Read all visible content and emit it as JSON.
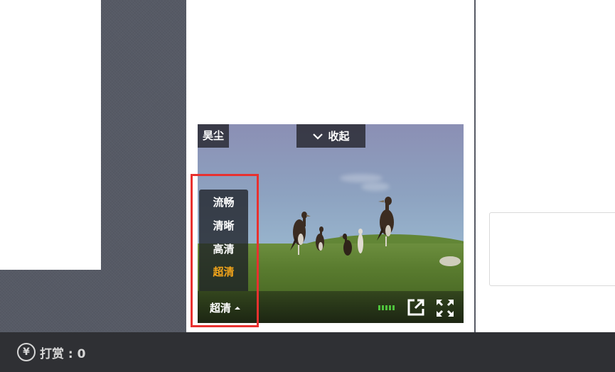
{
  "video": {
    "author_tag": "昊尘",
    "collapse_label": "收起",
    "quality": {
      "options": [
        "流畅",
        "清晰",
        "高清",
        "超清"
      ],
      "selected": "超清",
      "current_label": "超清"
    },
    "volume_level": 5
  },
  "footer": {
    "reward_label": "打赏 : 0",
    "reward_icon": "yen-coin-icon"
  },
  "colors": {
    "highlight": "#e8312f",
    "active_quality": "#f3a51a",
    "volume": "#4fc33c"
  }
}
